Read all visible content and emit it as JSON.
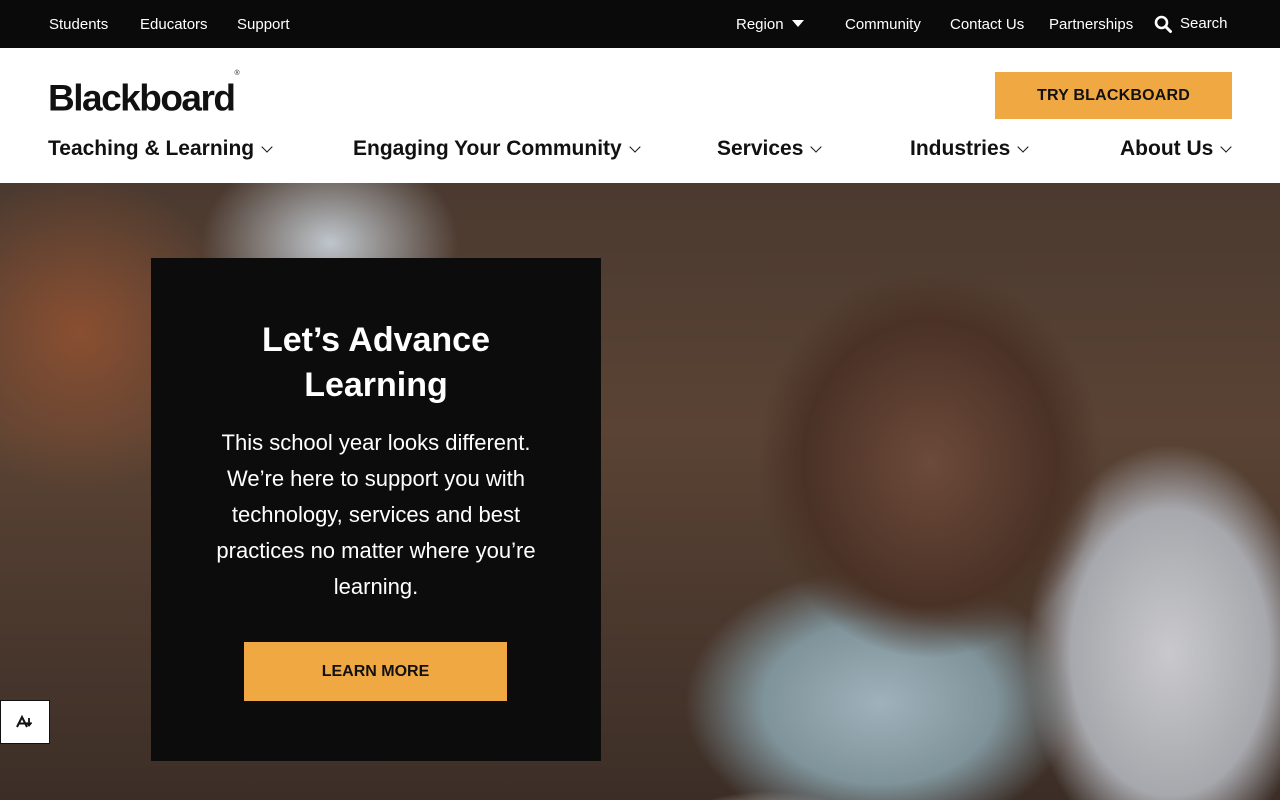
{
  "utility": {
    "left_links": [
      "Students",
      "Educators",
      "Support"
    ],
    "region_label": "Region",
    "right_links": [
      "Community",
      "Contact Us",
      "Partnerships"
    ],
    "search_label": "Search"
  },
  "header": {
    "logo_text": "Blackboard",
    "logo_mark": "®",
    "cta_label": "TRY BLACKBOARD"
  },
  "nav": {
    "items": [
      "Teaching & Learning",
      "Engaging Your Community",
      "Services",
      "Industries",
      "About Us"
    ]
  },
  "hero": {
    "title": "Let’s Advance Learning",
    "body": "This school year looks different. We’re here to support you with technology, services and best practices no matter where you’re learning.",
    "cta_label": "LEARN MORE"
  },
  "icons": {
    "search": "search-icon",
    "region": "caret-down-icon",
    "accessibility": "accessibility-icon"
  },
  "colors": {
    "accent": "#f0a843",
    "topbar": "#0a0a0a",
    "card": "#0c0c0c"
  }
}
